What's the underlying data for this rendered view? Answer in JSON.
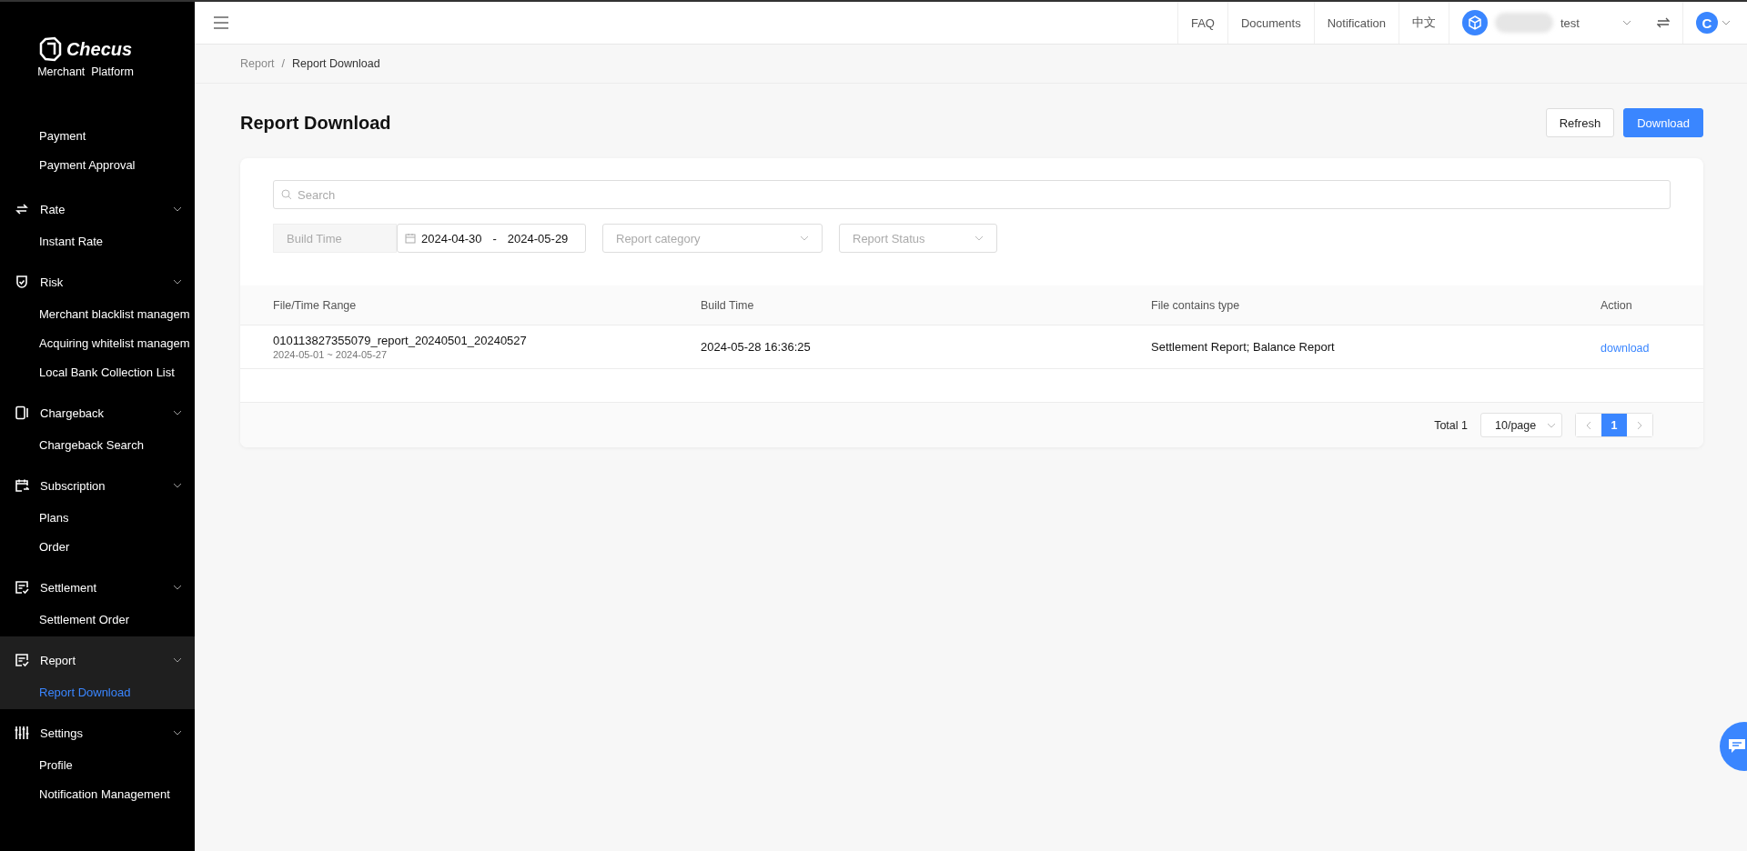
{
  "sidebar": {
    "logo": {
      "name": "Checus",
      "subtitle": "Merchant  Platform"
    },
    "sections": [
      {
        "items": [
          {
            "label": "Payment",
            "selected": false
          },
          {
            "label": "Payment Approval",
            "selected": false
          }
        ]
      },
      {
        "label": "Rate",
        "expanded": true,
        "items": [
          {
            "label": "Instant Rate",
            "selected": false
          }
        ]
      },
      {
        "label": "Risk",
        "expanded": true,
        "items": [
          {
            "label": "Merchant blacklist managem",
            "selected": false
          },
          {
            "label": "Acquiring whitelist managem",
            "selected": false
          },
          {
            "label": "Local Bank Collection List",
            "selected": false
          }
        ]
      },
      {
        "label": "Chargeback",
        "expanded": true,
        "items": [
          {
            "label": "Chargeback Search",
            "selected": false
          }
        ]
      },
      {
        "label": "Subscription",
        "expanded": true,
        "items": [
          {
            "label": "Plans",
            "selected": false
          },
          {
            "label": "Order",
            "selected": false
          }
        ]
      },
      {
        "label": "Settlement",
        "expanded": true,
        "items": [
          {
            "label": "Settlement Order",
            "selected": false
          }
        ]
      },
      {
        "label": "Report",
        "expanded": true,
        "items": [
          {
            "label": "Report Download",
            "selected": true
          }
        ]
      },
      {
        "label": "Settings",
        "expanded": true,
        "items": [
          {
            "label": "Profile",
            "selected": false
          },
          {
            "label": "Notification Management",
            "selected": false
          }
        ]
      }
    ]
  },
  "header": {
    "links": [
      "FAQ",
      "Documents",
      "Notification",
      "中文"
    ],
    "user": {
      "name": "test",
      "avatar_letter": "C"
    }
  },
  "breadcrumb": {
    "separator": "/",
    "items": [
      "Report",
      "Report Download"
    ]
  },
  "page": {
    "title": "Report Download",
    "buttons": [
      {
        "label": "Refresh",
        "kind": "default"
      },
      {
        "label": "Download",
        "kind": "primary"
      }
    ]
  },
  "filters": {
    "search": {
      "placeholder": "Search"
    },
    "date_range": {
      "label": "Build Time",
      "start": "2024-04-30",
      "separator": "-",
      "end": "2024-05-29"
    },
    "selects": [
      {
        "placeholder": "Report category"
      },
      {
        "placeholder": "Report Status"
      }
    ]
  },
  "table": {
    "columns": [
      "File/Time Range",
      "Build Time",
      "File contains type",
      "Action"
    ],
    "rows": [
      {
        "file": "010113827355079_report_20240501_20240527",
        "range": "2024-05-01 ~ 2024-05-27",
        "build_time": "2024-05-28 16:36:25",
        "types": "Settlement Report; Balance Report",
        "action": "download"
      }
    ]
  },
  "pagination": {
    "total": "Total 1",
    "page_size": "10/page",
    "pages": [
      {
        "label": "1",
        "selected": true
      }
    ]
  }
}
